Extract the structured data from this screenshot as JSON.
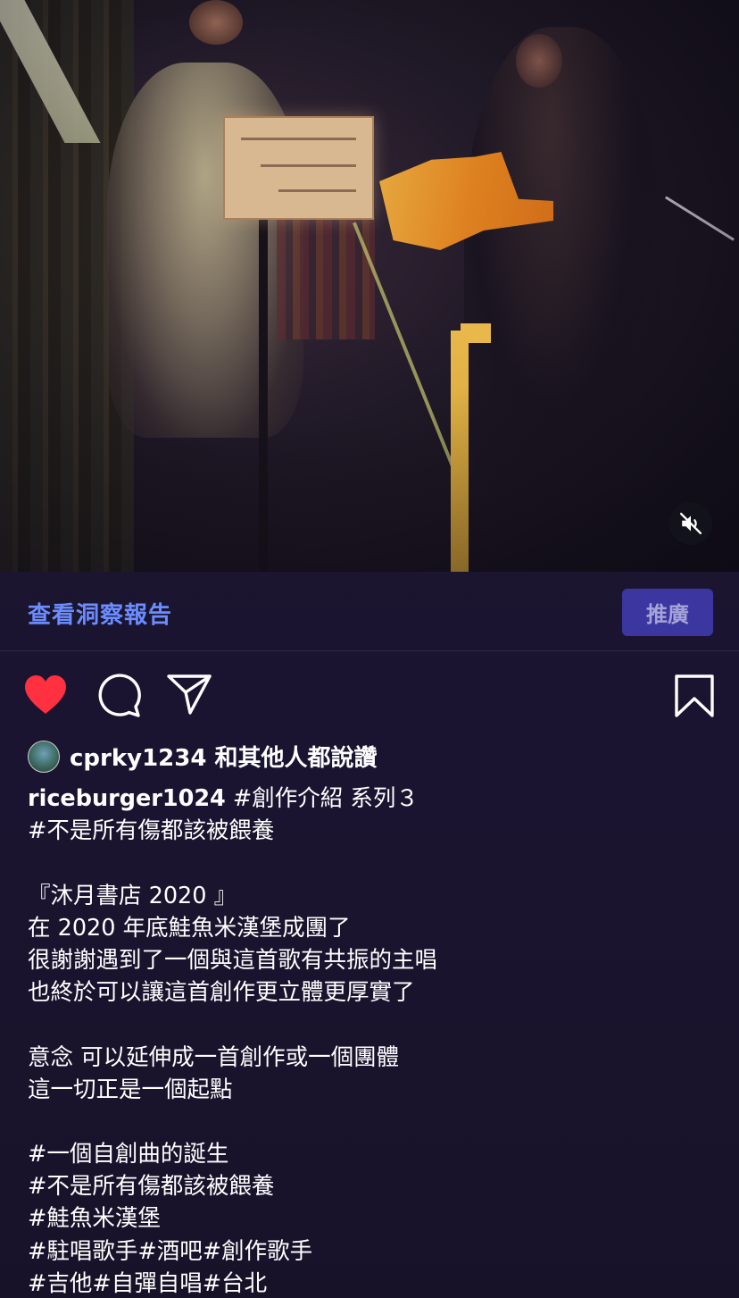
{
  "post": {
    "insights_link": "查看洞察報告",
    "promote_button": "推廣",
    "likes": {
      "user": "cprky1234",
      "suffix": "和其他人都說讚"
    },
    "caption": {
      "username": "riceburger1024",
      "first_line_text": " #創作介紹 系列３",
      "lines": [
        "#不是所有傷都該被餵養",
        "",
        "『沐月書店 2020 』",
        "在 2020 年底鮭魚米漢堡成團了",
        "很謝謝遇到了一個與這首歌有共振的主唱",
        "也終於可以讓這首創作更立體更厚實了",
        "",
        "意念 可以延伸成一首創作或一個團體",
        "這一切正是一個起點",
        "",
        "#一個自創曲的誕生",
        "#不是所有傷都該被餵養",
        "#鮭魚米漢堡",
        "#駐唱歌手#酒吧#創作歌手",
        "#吉他#自彈自唱#台北"
      ]
    }
  },
  "icons": {
    "mute": "speaker-muted-icon",
    "like": "heart-icon",
    "comment": "comment-bubble-icon",
    "share": "paper-plane-icon",
    "save": "bookmark-icon"
  },
  "colors": {
    "background": "#1b1530",
    "link": "#6b8cff",
    "promote_bg": "#3b36a0",
    "heart": "#ff3040"
  }
}
